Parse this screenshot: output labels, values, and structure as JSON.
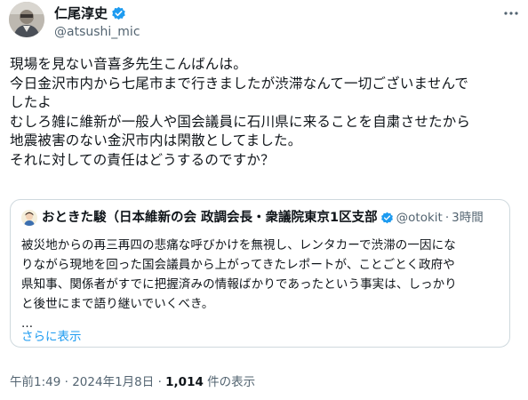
{
  "author": {
    "display_name": "仁尾淳史",
    "handle": "@atsushi_mic",
    "avatar_icon": "person-photo-avatar",
    "verified_color": "#1d9bf0"
  },
  "tweet": {
    "lines": [
      "現場を見ない音喜多先生こんばんは。",
      "今日金沢市内から七尾市まで行きましたが渋滞なんて一切ございませんで",
      "したよ",
      "むしろ雑に維新が一般人や国会議員に石川県に来ることを自粛させたから",
      "地震被害のない金沢市内は閑散としてました。",
      "それに対しての責任はどうするのですか？"
    ]
  },
  "quote": {
    "display_name": "おときた駿（日本維新の会 政調会長・衆議院東京1区支部",
    "handle": "@otokit",
    "separator": "·",
    "time": "3時間",
    "avatar_icon": "illustrated-avatar",
    "lines": [
      "被災地からの再三再四の悲痛な呼びかけを無視し、レンタカーで渋滞の一因にな",
      "りながら現地を回った国会議員から上がってきたレポートが、ことごとく政府や",
      "県知事、関係者がすでに把握済みの情報ばかりであったという事実は、しっかり",
      "と後世にまで語り継いでいくべき。",
      "..."
    ],
    "show_more": "さらに表示"
  },
  "meta": {
    "time": "午前1:49",
    "sep1": "·",
    "date": "2024年1月8日",
    "sep2": "·",
    "views_count": "1,014",
    "views_label": " 件の表示"
  },
  "colors": {
    "text": "#0f1419",
    "secondary": "#536471",
    "link": "#1d9bf0",
    "border": "#cfd9de"
  }
}
